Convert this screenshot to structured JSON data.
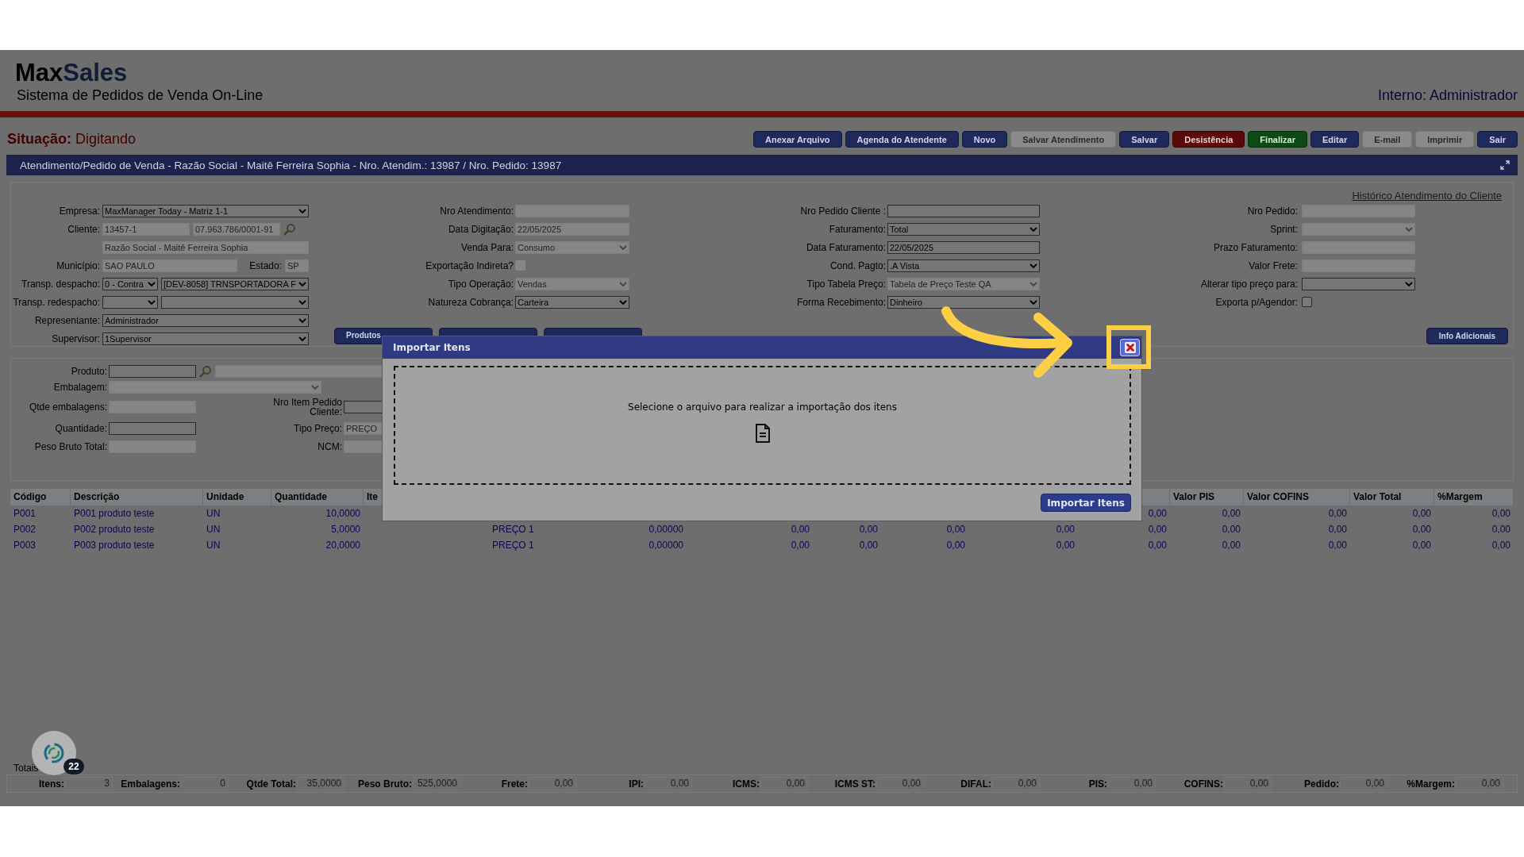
{
  "header": {
    "logo": {
      "part1": "Max",
      "part2": "Sales"
    },
    "subtitle": "Sistema de Pedidos de Venda On-Line",
    "user": "Interno: Administrador"
  },
  "status": {
    "label": "Situação:",
    "value": "Digitando"
  },
  "toolbar": [
    {
      "label": "Anexar Arquivo",
      "kind": "primary",
      "disabled": false
    },
    {
      "label": "Agenda do Atendente",
      "kind": "primary",
      "disabled": false
    },
    {
      "label": "Novo",
      "kind": "primary",
      "disabled": false
    },
    {
      "label": "Salvar Atendimento",
      "kind": "primary",
      "disabled": true
    },
    {
      "label": "Salvar",
      "kind": "primary",
      "disabled": false
    },
    {
      "label": "Desistência",
      "kind": "danger",
      "disabled": false
    },
    {
      "label": "Finalizar",
      "kind": "success",
      "disabled": false
    },
    {
      "label": "Editar",
      "kind": "primary",
      "disabled": false
    },
    {
      "label": "E-mail",
      "kind": "primary",
      "disabled": true
    },
    {
      "label": "Imprimir",
      "kind": "primary",
      "disabled": true
    },
    {
      "label": "Sair",
      "kind": "primary",
      "disabled": false
    }
  ],
  "title_bar": {
    "text": "Atendimento/Pedido de Venda - Razão Social - Maitê Ferreira Sophia - Nro. Atendim.: 13987 / Nro. Pedido: 13987"
  },
  "form": {
    "history_link": "Histórico Atendimento do Cliente",
    "columns": [
      {
        "rows": [
          {
            "label": "Empresa:",
            "controls": [
              {
                "kind": "select",
                "value": "MaxManager Today - Matriz 1-1",
                "disabled": false
              }
            ]
          },
          {
            "label": "Cliente:",
            "controls": [
              {
                "kind": "input",
                "value": "13457-1",
                "disabled": true
              },
              {
                "kind": "input",
                "value": "07.963.786/0001-91",
                "disabled": true
              },
              {
                "kind": "search"
              }
            ]
          },
          {
            "controls": [
              {
                "kind": "input",
                "value": "Razão Social - Maitê Ferreira Sophia",
                "disabled": true
              }
            ]
          },
          {
            "label": "Município:",
            "controls": [
              {
                "kind": "input",
                "value": "SAO PAULO",
                "disabled": true
              },
              {
                "kind": "label",
                "text": "Estado:"
              },
              {
                "kind": "input",
                "value": "SP",
                "disabled": true
              }
            ]
          },
          {
            "label": "Transp. despacho:",
            "controls": [
              {
                "kind": "select",
                "value": "0 - Contra",
                "disabled": false
              },
              {
                "kind": "select",
                "value": "[DEV-8058] TRNSPORTADORA F",
                "disabled": false
              }
            ]
          },
          {
            "label": "Transp. redespacho:",
            "controls": [
              {
                "kind": "select",
                "disabled": false
              },
              {
                "kind": "select",
                "disabled": false
              }
            ]
          },
          {
            "label": "Representante:",
            "controls": [
              {
                "kind": "select",
                "value": "Administrador",
                "disabled": false
              }
            ]
          },
          {
            "label": "Supervisor:",
            "controls": [
              {
                "kind": "select",
                "value": "1Supervisor",
                "disabled": false
              }
            ]
          }
        ]
      },
      {
        "rows": [
          {
            "label": "Nro Atendimento:",
            "controls": [
              {
                "kind": "input",
                "disabled": true
              }
            ]
          },
          {
            "label": "Data Digitação:",
            "controls": [
              {
                "kind": "input",
                "value": "22/05/2025",
                "disabled": true
              }
            ]
          },
          {
            "label": "Venda Para:",
            "controls": [
              {
                "kind": "select",
                "value": "Consumo",
                "disabled": true
              }
            ]
          },
          {
            "label": "Exportação Indireta?",
            "controls": [
              {
                "kind": "checkbox",
                "checked": false,
                "disabled": true
              }
            ]
          },
          {
            "label": "Tipo Operação:",
            "controls": [
              {
                "kind": "select",
                "value": "Vendas",
                "disabled": true
              }
            ]
          },
          {
            "label": "Natureza Cobrança:",
            "controls": [
              {
                "kind": "select",
                "value": "Carteira",
                "disabled": false
              }
            ]
          }
        ]
      },
      {
        "rows": [
          {
            "label": "Nro Pedido Cliente :",
            "controls": [
              {
                "kind": "input",
                "disabled": false
              }
            ]
          },
          {
            "label": "Faturamento:",
            "controls": [
              {
                "kind": "select",
                "value": "Total",
                "disabled": false
              }
            ]
          },
          {
            "label": "Data Faturamento:",
            "controls": [
              {
                "kind": "input",
                "value": "22/05/2025",
                "disabled": false
              }
            ]
          },
          {
            "label": "Cond. Pagto:",
            "controls": [
              {
                "kind": "select",
                "value": ".A Vista",
                "disabled": false
              }
            ]
          },
          {
            "label": "Tipo Tabela Preço:",
            "controls": [
              {
                "kind": "select",
                "value": "Tabela de Preço Teste QA",
                "disabled": true
              }
            ]
          },
          {
            "label": "Forma Recebimento:",
            "controls": [
              {
                "kind": "select",
                "value": "Dinheiro",
                "disabled": false
              }
            ]
          }
        ]
      },
      {
        "rows": [
          {
            "label": "Nro Pedido:",
            "controls": [
              {
                "kind": "input",
                "disabled": true
              }
            ]
          },
          {
            "label": "Sprint:",
            "controls": [
              {
                "kind": "select",
                "disabled": true
              }
            ]
          },
          {
            "label": "Prazo Faturamento:",
            "controls": [
              {
                "kind": "input",
                "disabled": true
              }
            ]
          },
          {
            "label": "Valor Frete:",
            "controls": [
              {
                "kind": "input",
                "disabled": true
              }
            ]
          },
          {
            "label": "Alterar tipo preço para:",
            "controls": [
              {
                "kind": "select",
                "disabled": false
              }
            ]
          },
          {
            "label": "Exporta p/Agendor:",
            "controls": [
              {
                "kind": "checkbox",
                "checked": false,
                "disabled": false
              }
            ]
          }
        ]
      }
    ],
    "action_buttons": [
      {
        "kind": "labelled",
        "label": "Produtos"
      },
      {
        "kind": "covered"
      },
      {
        "kind": "covered"
      }
    ],
    "info_button": "Info Adicionais"
  },
  "product_panel": {
    "rows": [
      {
        "cells": [
          {
            "label": "Produto:",
            "controls": [
              {
                "kind": "input",
                "disabled": false
              },
              {
                "kind": "search"
              },
              {
                "kind": "input",
                "disabled": true
              }
            ]
          }
        ]
      },
      {
        "cells": [
          {
            "label": "Embalagem:",
            "controls": [
              {
                "kind": "select",
                "disabled": true
              }
            ]
          }
        ]
      },
      {
        "cells": [
          {
            "label": "Qtde embalagens:",
            "controls": [
              {
                "kind": "input",
                "disabled": true
              }
            ]
          },
          {
            "label": "Nro Item Pedido Cliente:",
            "controls": [
              {
                "kind": "input",
                "disabled": false
              }
            ]
          }
        ]
      },
      {
        "cells": [
          {
            "label": "Quantidade:",
            "controls": [
              {
                "kind": "input",
                "disabled": false
              }
            ]
          },
          {
            "label": "Tipo Preço:",
            "controls": [
              {
                "kind": "input",
                "value": "PREÇO",
                "disabled": true
              }
            ]
          }
        ]
      },
      {
        "cells": [
          {
            "label": "Peso Bruto Total:",
            "controls": [
              {
                "kind": "input",
                "disabled": true
              }
            ]
          },
          {
            "label": "NCM:",
            "controls": [
              {
                "kind": "input",
                "disabled": true
              }
            ]
          }
        ]
      }
    ]
  },
  "items_table": {
    "columns": [
      {
        "header": "Código"
      },
      {
        "header": "Descrição"
      },
      {
        "header": "Unidade"
      },
      {
        "header": "Quantidade"
      },
      {
        "header": "Ite"
      },
      {},
      {},
      {},
      {},
      {},
      {},
      {},
      {
        "header": "Valor PIS"
      },
      {
        "header": "Valor COFINS"
      },
      {
        "header": "Valor Total"
      },
      {
        "header": "%Margem"
      }
    ],
    "rows": [
      {
        "cells": [
          "P001",
          "P001 produto teste",
          "UN",
          "10,0000",
          null,
          null,
          null,
          null,
          null,
          null,
          null,
          "0,00",
          "0,00",
          "0,00",
          "0,00",
          "0,00"
        ]
      },
      {
        "cells": [
          "P002",
          "P002 produto teste",
          "UN",
          "5,0000",
          null,
          "PREÇO 1",
          "0,00000",
          "0,00",
          "0,00",
          "0,00",
          "0,00",
          "0,00",
          "0,00",
          "0,00",
          "0,00",
          "0,00"
        ]
      },
      {
        "cells": [
          "P003",
          "P003 produto teste",
          "UN",
          "20,0000",
          null,
          "PREÇO 1",
          "0,00000",
          "0,00",
          "0,00",
          "0,00",
          "0,00",
          "0,00",
          "0,00",
          "0,00",
          "0,00",
          "0,00"
        ]
      }
    ]
  },
  "totals": {
    "legend": "Totais",
    "fields": [
      {
        "label": "Itens:",
        "value": "3"
      },
      {
        "label": "Embalagens:",
        "value": "0"
      },
      {
        "label": "Qtde Total:",
        "value": "35,0000"
      },
      {
        "label": "Peso Bruto:",
        "value": "525,0000"
      },
      {
        "label": "Frete:",
        "value": "0,00"
      },
      {
        "label": "IPI:",
        "value": "0,00"
      },
      {
        "label": "ICMS:",
        "value": "0,00"
      },
      {
        "label": "ICMS ST:",
        "value": "0,00"
      },
      {
        "label": "DIFAL:",
        "value": "0,00"
      },
      {
        "label": "PIS:",
        "value": "0,00"
      },
      {
        "label": "COFINS:",
        "value": "0,00"
      },
      {
        "label": "Pedido:",
        "value": "0,00"
      },
      {
        "label": "%Margem:",
        "value": "0,00"
      }
    ]
  },
  "chat_widget": {
    "badge": "22"
  },
  "modal": {
    "title": "Importar Itens",
    "message": "Selecione o arquivo para realizar a importação dos itens",
    "button": "Importar Itens"
  }
}
